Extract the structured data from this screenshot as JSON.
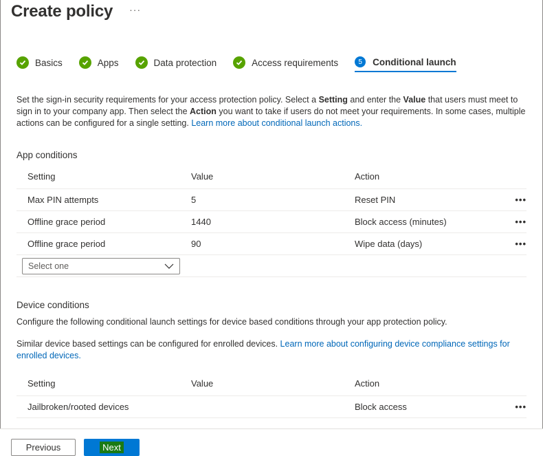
{
  "header": {
    "title": "Create policy",
    "more": "···"
  },
  "steps": [
    {
      "label": "Basics",
      "state": "done"
    },
    {
      "label": "Apps",
      "state": "done"
    },
    {
      "label": "Data protection",
      "state": "done"
    },
    {
      "label": "Access requirements",
      "state": "done"
    },
    {
      "label": "Conditional launch",
      "state": "active",
      "number": "5"
    }
  ],
  "intro": {
    "part1": "Set the sign-in security requirements for your access protection policy. Select a ",
    "bold1": "Setting",
    "part2": " and enter the ",
    "bold2": "Value",
    "part3": " that users must meet to sign in to your company app. Then select the ",
    "bold3": "Action",
    "part4": " you want to take if users do not meet your requirements. In some cases, multiple actions can be configured for a single setting. ",
    "link": "Learn more about conditional launch actions."
  },
  "app_conditions": {
    "title": "App conditions",
    "columns": [
      "Setting",
      "Value",
      "Action"
    ],
    "rows": [
      {
        "setting": "Max PIN attempts",
        "value": "5",
        "action": "Reset PIN"
      },
      {
        "setting": "Offline grace period",
        "value": "1440",
        "action": "Block access (minutes)"
      },
      {
        "setting": "Offline grace period",
        "value": "90",
        "action": "Wipe data (days)"
      }
    ],
    "select_placeholder": "Select one",
    "row_more": "•••"
  },
  "device_conditions": {
    "title": "Device conditions",
    "desc": "Configure the following conditional launch settings for device based conditions through your app protection policy.",
    "desc2": "Similar device based settings can be configured for enrolled devices. ",
    "link": "Learn more about configuring device compliance settings for enrolled devices.",
    "columns": [
      "Setting",
      "Value",
      "Action"
    ],
    "rows": [
      {
        "setting": "Jailbroken/rooted devices",
        "value": "",
        "action": "Block access"
      }
    ]
  },
  "footer": {
    "previous": "Previous",
    "next": "Next"
  },
  "colors": {
    "accent": "#0078d4",
    "success": "#57a300",
    "link": "#0067b8"
  }
}
